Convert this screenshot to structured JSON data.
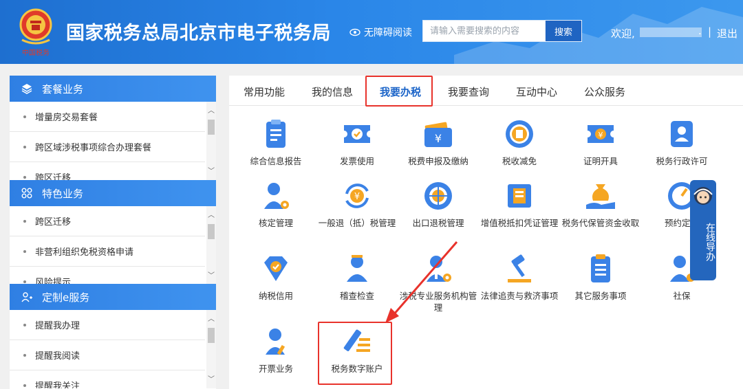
{
  "header": {
    "title": "国家税务总局北京市电子税务局",
    "emblem_caption": "中国税务",
    "accessibility": "无障碍阅读",
    "search_placeholder": "请输入需要搜索的内容",
    "search_button": "搜索",
    "welcome": "欢迎,",
    "user_suffix": ".",
    "separator": "|",
    "logout": "退出"
  },
  "sidebar": {
    "sections": [
      {
        "title": "套餐业务",
        "icon": "layers-icon",
        "items": [
          "增量房交易套餐",
          "跨区域涉税事项综合办理套餐",
          "跨区迁移"
        ]
      },
      {
        "title": "特色业务",
        "icon": "grid-icon",
        "items": [
          "跨区迁移",
          "非营利组织免税资格申请",
          "风险提示"
        ]
      },
      {
        "title": "定制e服务",
        "icon": "user-plus-icon",
        "items": [
          "提醒我办理",
          "提醒我阅读",
          "提醒我关注"
        ]
      }
    ]
  },
  "tabs": [
    "常用功能",
    "我的信息",
    "我要办税",
    "我要查询",
    "互动中心",
    "公众服务"
  ],
  "active_tab": "我要办税",
  "tiles": [
    {
      "label": "综合信息报告",
      "icon": "clipboard-icon"
    },
    {
      "label": "发票使用",
      "icon": "ticket-icon"
    },
    {
      "label": "税费申报及缴纳",
      "icon": "wallet-yuan-icon"
    },
    {
      "label": "税收减免",
      "icon": "tax-seal-icon"
    },
    {
      "label": "证明开具",
      "icon": "certificate-yuan-icon"
    },
    {
      "label": "税务行政许可",
      "icon": "id-badge-icon"
    },
    {
      "label": "核定管理",
      "icon": "user-gear-icon"
    },
    {
      "label": "一般退（抵）税管理",
      "icon": "refund-yuan-icon"
    },
    {
      "label": "出口退税管理",
      "icon": "globe-icon"
    },
    {
      "label": "增值税抵扣凭证管理",
      "icon": "vat-voucher-icon"
    },
    {
      "label": "税务代保管资金收取",
      "icon": "money-bag-hand-icon"
    },
    {
      "label": "预约定价",
      "icon": "gauge-icon"
    },
    {
      "label": "纳税信用",
      "icon": "diamond-check-icon"
    },
    {
      "label": "稽查检查",
      "icon": "inspector-icon"
    },
    {
      "label": "涉税专业服务机构管理",
      "icon": "agent-gear-icon"
    },
    {
      "label": "法律追责与救济事项",
      "icon": "gavel-icon"
    },
    {
      "label": "其它服务事项",
      "icon": "list-doc-icon"
    },
    {
      "label": "社保",
      "icon": "user-shield-icon"
    },
    {
      "label": "开票业务",
      "icon": "user-pen-icon"
    },
    {
      "label": "税务数字账户",
      "icon": "pen-lines-icon"
    }
  ],
  "online_guide": "在线导办",
  "colors": {
    "header_blue": "#2a86e8",
    "accent_blue": "#1b64c8",
    "highlight_red": "#e8322b"
  }
}
